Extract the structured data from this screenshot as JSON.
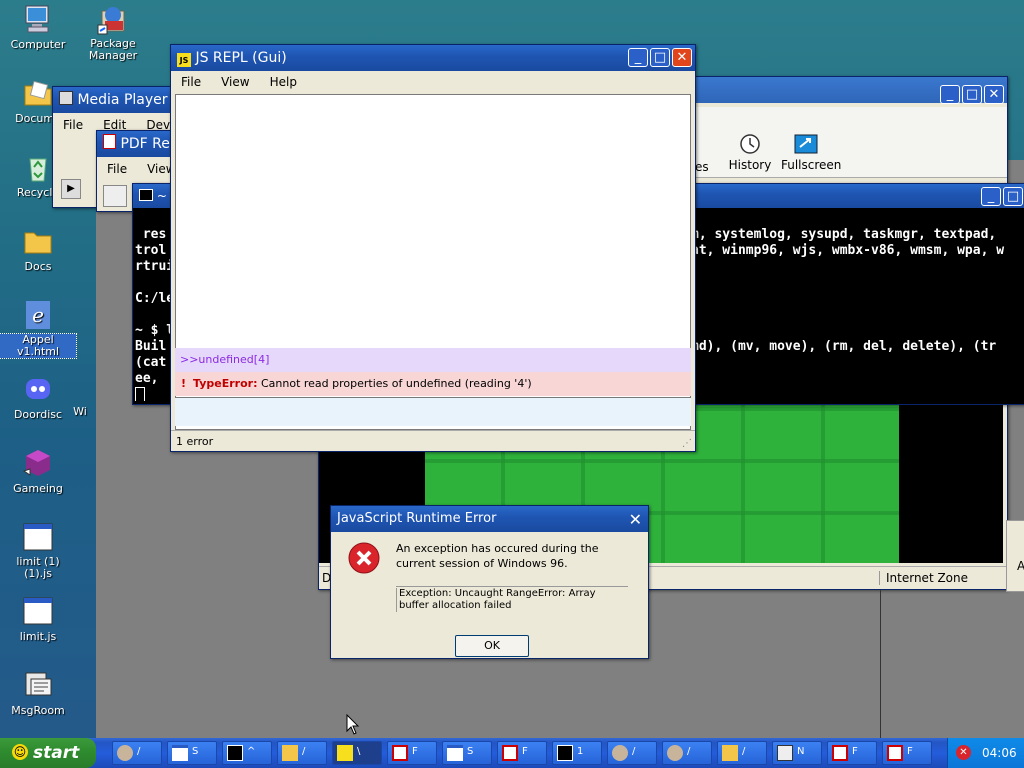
{
  "desktop_icons": [
    {
      "label": "Computer"
    },
    {
      "label": "Package Manager"
    },
    {
      "label": "Docume"
    },
    {
      "label": "Recycle"
    },
    {
      "label": "Docs"
    },
    {
      "label": "Appel v1.html"
    },
    {
      "label": "Doordisc"
    },
    {
      "label": "Wi"
    },
    {
      "label": "Gameing"
    },
    {
      "label": "limit (1) (1).js"
    },
    {
      "label": "limit.js"
    },
    {
      "label": "MsgRoom"
    }
  ],
  "media_player": {
    "title": "Media Player",
    "menu": [
      "File",
      "Edit",
      "Device"
    ]
  },
  "pdf_reader": {
    "title": "PDF Rea",
    "menu": [
      "File",
      "View"
    ]
  },
  "browser": {
    "toolbar": [
      {
        "label": "es"
      },
      {
        "label": "History"
      },
      {
        "label": "Fullscreen"
      }
    ],
    "status_left": "D",
    "status_zone": "Internet Zone",
    "right_edge": "A"
  },
  "terminal": {
    "title": "~",
    "left_lines": [
      " res",
      "trol",
      "rtrui",
      "",
      "C:/le",
      "",
      "~ $ l",
      "Buil",
      "(cat",
      "ee,",
      ""
    ],
    "right_lines": [
      "m, systemlog, sysupd, taskmgr, textpad,",
      "at, winmp96, wjs, wmbx-v86, wmsm, wpa, w",
      "",
      "",
      "",
      "",
      "",
      "md), (mv, move), (rm, del, delete), (tr",
      "",
      ""
    ]
  },
  "repl": {
    "title": "JS REPL (Gui)",
    "menu": [
      "File",
      "View",
      "Help"
    ],
    "input_echo": ">>undefined[4]",
    "error_type": "TypeError:",
    "error_msg": "Cannot read properties of undefined (reading '4')",
    "status": "1 error"
  },
  "dialog": {
    "title": "JavaScript Runtime Error",
    "message": "An exception has occured during the current session of Windows 96.",
    "detail": "Exception: Uncaught RangeError: Array buffer allocation failed",
    "ok": "OK"
  },
  "taskbar": {
    "start": "start",
    "items": [
      {
        "label": "/"
      },
      {
        "label": "S"
      },
      {
        "label": "^"
      },
      {
        "label": "/"
      },
      {
        "label": "\\"
      },
      {
        "label": "F"
      },
      {
        "label": "S"
      },
      {
        "label": "F"
      },
      {
        "label": "1"
      },
      {
        "label": "/"
      },
      {
        "label": "/"
      },
      {
        "label": "/"
      },
      {
        "label": "N"
      },
      {
        "label": "F"
      },
      {
        "label": "F"
      }
    ],
    "clock": "04:06"
  },
  "colors": {
    "accent": "#1f56b3",
    "error": "#e0451c",
    "start": "#2f8d2f"
  }
}
